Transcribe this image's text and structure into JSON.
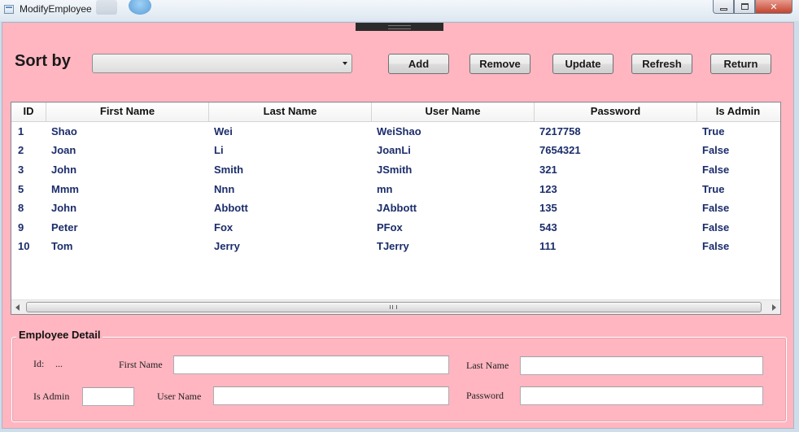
{
  "window": {
    "title": "ModifyEmployee"
  },
  "toolbar": {
    "sort_label": "Sort by",
    "sort_value": "",
    "buttons": {
      "add": "Add",
      "remove": "Remove",
      "update": "Update",
      "refresh": "Refresh",
      "return": "Return"
    }
  },
  "grid": {
    "columns": [
      "ID",
      "First Name",
      "Last Name",
      "User Name",
      "Password",
      "Is Admin"
    ],
    "rows": [
      [
        "1",
        "Shao",
        "Wei",
        "WeiShao",
        "7217758",
        "True"
      ],
      [
        "2",
        "Joan",
        "Li",
        "JoanLi",
        "7654321",
        "False"
      ],
      [
        "3",
        "John",
        "Smith",
        "JSmith",
        "321",
        "False"
      ],
      [
        "5",
        "Mmm",
        "Nnn",
        "mn",
        "123",
        "True"
      ],
      [
        "8",
        "John",
        "Abbott",
        "JAbbott",
        "135",
        "False"
      ],
      [
        "9",
        "Peter",
        "Fox",
        "PFox",
        "543",
        "False"
      ],
      [
        "10",
        "Tom",
        "Jerry",
        "TJerry",
        "111",
        "False"
      ]
    ],
    "text_color": "#1b2d6b"
  },
  "detail": {
    "title": "Employee Detail",
    "id_label": "Id:",
    "id_value": "...",
    "first_name_label": "First Name",
    "last_name_label": "Last Name",
    "is_admin_label": "Is Admin",
    "user_name_label": "User Name",
    "password_label": "Password",
    "first_name_value": "",
    "last_name_value": "",
    "is_admin_value": "",
    "user_name_value": "",
    "password_value": ""
  },
  "colors": {
    "background": "#ffb6c1"
  }
}
